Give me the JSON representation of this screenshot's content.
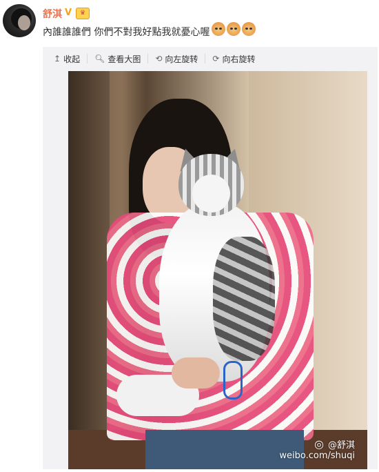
{
  "user": {
    "name": "舒淇",
    "verified_mark": "V"
  },
  "post": {
    "text": "內誰誰誰們 你們不對我好點我就憂心喔"
  },
  "emojis": [
    "cat-emoji",
    "cat-emoji",
    "cat-emoji"
  ],
  "toolbar": {
    "items": [
      {
        "icon": "↥",
        "label": "收起"
      },
      {
        "icon": "🔍︎",
        "label": "查看大图"
      },
      {
        "icon": "⟲",
        "label": "向左旋转"
      },
      {
        "icon": "⟳",
        "label": "向右旋转"
      }
    ]
  },
  "watermark": {
    "handle": "@舒淇",
    "url": "weibo.com/shuqi"
  },
  "colors": {
    "username": "#eb7350",
    "panel_bg": "#f2f2f5",
    "verified": "#f6a117"
  }
}
